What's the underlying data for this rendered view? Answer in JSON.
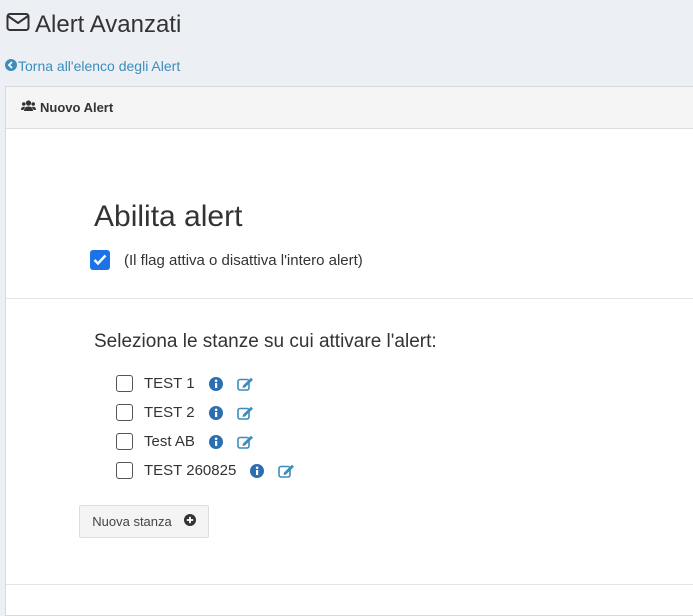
{
  "header": {
    "title": "Alert Avanzati",
    "icon": "envelope-icon"
  },
  "back_link": {
    "label": "Torna all'elenco degli Alert",
    "icon": "chevron-circle-left-icon"
  },
  "panel": {
    "heading": "Nuovo Alert",
    "heading_icon": "users-icon",
    "enable_section": {
      "title": "Abilita alert",
      "checkbox_checked": true,
      "checkbox_label": "(Il flag attiva o disattiva l'intero alert)"
    },
    "rooms_section": {
      "label": "Seleziona le stanze su cui attivare l'alert:",
      "rooms": [
        {
          "name": "TEST 1",
          "checked": false
        },
        {
          "name": "TEST 2",
          "checked": false
        },
        {
          "name": "Test AB",
          "checked": false
        },
        {
          "name": "TEST 260825",
          "checked": false
        }
      ],
      "new_room_button": "Nuova stanza"
    }
  },
  "colors": {
    "link": "#3c8dbc",
    "checkbox": "#1a73e8",
    "info_icon": "#2c6fb0"
  }
}
